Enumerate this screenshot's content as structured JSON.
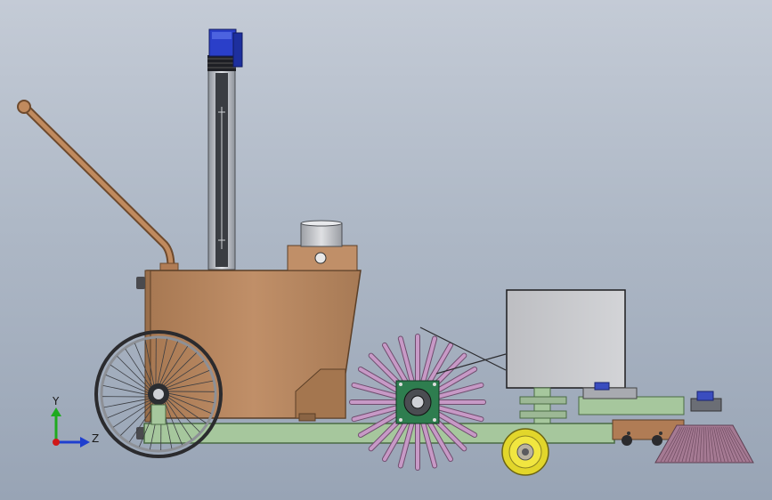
{
  "viewport": {
    "background_top": "#c4cbd6",
    "background_bottom": "#98a4b5"
  },
  "triad": {
    "y_label": "Y",
    "z_label": "Z",
    "y_color": "#1faa1f",
    "z_color": "#1f3fcf",
    "origin_color": "#d01818"
  },
  "model": {
    "description_icons": [
      "motor-icon",
      "handle-icon",
      "wheel-icon",
      "roller-brush-icon",
      "side-brush-icon",
      "caster-wheel-icon"
    ],
    "colors": {
      "hopper": "#b7875f",
      "hopper_dark": "#8a6444",
      "handle": "#b27b52",
      "frame": "#a6c79d",
      "frame_dark": "#6f9467",
      "motor": "#2a3fc9",
      "column": "#c9ccd2",
      "box": "#c8c8ca",
      "bristle": "#c799c6",
      "bearing": "#2e7d4f",
      "caster": "#e8dd2a",
      "side_brush": "#9e6a86"
    }
  }
}
